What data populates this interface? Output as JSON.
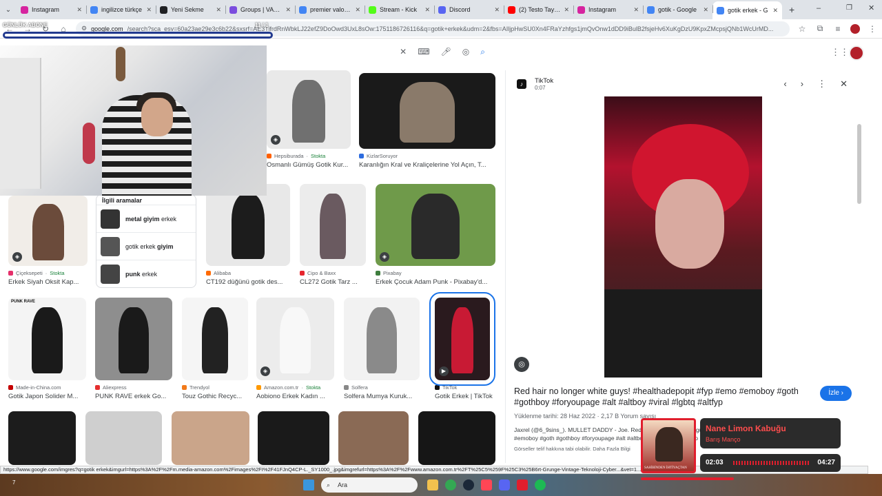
{
  "tabs": [
    {
      "label": "Instagram",
      "color": "#d6249f"
    },
    {
      "label": "ingilizce türkçe",
      "color": "#4285f4"
    },
    {
      "label": "Yeni Sekme",
      "color": "#202124"
    },
    {
      "label": "Groups | VALOR",
      "color": "#7b4dde"
    },
    {
      "label": "premier valorant",
      "color": "#4285f4"
    },
    {
      "label": "Stream - Kick",
      "color": "#53fc18"
    },
    {
      "label": "Discord",
      "color": "#5865f2"
    },
    {
      "label": "(2) Testo Taylan",
      "color": "#ff0000"
    },
    {
      "label": "Instagram",
      "color": "#d6249f"
    },
    {
      "label": "gotik - Google",
      "color": "#4285f4"
    },
    {
      "label": "gotik erkek - G",
      "color": "#4285f4",
      "active": true
    }
  ],
  "address": {
    "host": "google.com",
    "path": "/search?sca_esv=60a23ae29e3c6b22&sxsrf=AE3TifrdRnWbkLJ22efZ9DoOwd3UxL8sOw:1751186726116&q=gotik+erkek&udm=2&fbs=AIljpHwSU0Xn4FRaYzhfgs1jmQvOnw1dDD9iBulB2fsjeHv6XuKgDzU9KpxZMcpsjQNb1WcUrMD..."
  },
  "overlay": {
    "label": "GÜNLÜK ABONE",
    "counter": "11 / 1"
  },
  "related": {
    "header": "İlgili aramalar",
    "items": [
      {
        "bold": "metal giyim",
        "rest": " erkek"
      },
      {
        "bold": "",
        "rest": "gotik erkek ",
        "bold2": "giyim"
      },
      {
        "bold": "punk",
        "rest": " erkek"
      }
    ]
  },
  "results": [
    {
      "source": "Hepsiburada",
      "stock": "Stokta",
      "caption": "Osmanlı Gümüş Gotik Kur..."
    },
    {
      "source": "KizlarSoruyor",
      "stock": "",
      "caption": "Karanlığın Kral ve Kraliçelerine Yol Açın, T..."
    },
    {
      "source": "Çiçeksepeti",
      "stock": "Stokta",
      "caption": "Erkek Siyah Oksit Kap..."
    },
    {
      "source": "Alibaba",
      "stock": "",
      "caption": "CT192 düğünü gotik des..."
    },
    {
      "source": "Cipo & Baxx",
      "stock": "",
      "caption": "CL272 Gotik Tarz ..."
    },
    {
      "source": "Pixabay",
      "stock": "",
      "caption": "Erkek Çocuk Adam Punk - Pixabay'd..."
    },
    {
      "source": "Made-in-China.com",
      "stock": "",
      "caption": "Gotik Japon Solider M..."
    },
    {
      "source": "Aliexpress",
      "stock": "",
      "caption": "PUNK RAVE erkek Go..."
    },
    {
      "source": "Trendyol",
      "stock": "",
      "caption": "Touz Gothic Recyc..."
    },
    {
      "source": "Amazon.com.tr",
      "stock": "Stokta",
      "caption": "Aobiono Erkek Kadın ..."
    },
    {
      "source": "Solfera",
      "stock": "",
      "caption": "Solfera Mumya Kuruk..."
    },
    {
      "source": "TikTok",
      "stock": "",
      "caption": "Gotik Erkek | TikTok"
    }
  ],
  "punk_rave_label": "PUNK RAVE",
  "panel": {
    "site": "TikTok",
    "duration": "0:07",
    "title": "Red hair no longer white guys! #healthadepopit #fyp #emo #emoboy #goth #gothboy #foryoupage #alt #altboy #viral #lgbtq #altfyp",
    "visit": "İzle",
    "date": "Yüklenme tarihi: 28 Haz 2022 · 2,17 B Yorum sayısı",
    "meta1": "Jaxrel (@6_9sins_). MULLET DADDY - Joe. Red hair no longer white guys! #healthadepopit #fyp #emo",
    "meta2": "#emoboy #goth #gothboy #foryoupage #alt #altboy #viral #lgbtq #altfyp",
    "copyright": "Görseller telif hakkına tabi olabilir. Daha Fazla Bilgi"
  },
  "status_url": "https://www.google.com/imgres?q=gotik erkek&imgurl=https%3A%2F%2Fm.media-amazon.com%2Fimages%2FI%2F41FJnQ4CP-L._SY1000_.jpg&imgrefurl=https%3A%2F%2Fwww.amazon.com.tr%2FT%25C5%259F%25C3%25B6rt-Grunge-Vintage-Teknoloji-Cyber...&vet=1...",
  "taskbar": {
    "search_placeholder": "Ara",
    "weather": "7"
  },
  "music": {
    "title": "Nane Limon Kabuğu",
    "artist": "Barış Manço",
    "elapsed": "02:03",
    "total": "04:27",
    "cover_text": "SAHİBİNDEN İHTİYAÇTAN"
  }
}
